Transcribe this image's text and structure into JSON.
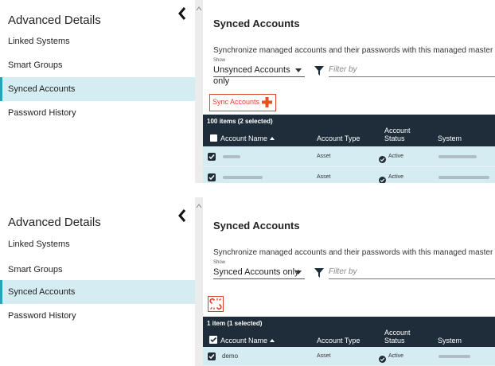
{
  "sidebar": {
    "title": "Advanced Details",
    "items": [
      {
        "label": "Linked Systems"
      },
      {
        "label": "Smart Groups"
      },
      {
        "label": "Synced Accounts"
      },
      {
        "label": "Password History"
      }
    ]
  },
  "panel1": {
    "title": "Synced Accounts",
    "description": "Synchronize managed accounts and their passwords with this managed master account.",
    "show_label": "Show",
    "show_value": "Unsynced Accounts only",
    "filter_placeholder": "Filter by",
    "sync_button": "Sync Accounts",
    "table": {
      "count": "100 items (2 selected)",
      "columns": {
        "name": "Account Name",
        "type": "Account Type",
        "status_line1": "Account",
        "status_line2": "Status",
        "system": "System"
      },
      "rows": [
        {
          "type": "Asset",
          "status": "Active"
        },
        {
          "type": "Asset",
          "status": "Active"
        }
      ]
    }
  },
  "panel2": {
    "title": "Synced Accounts",
    "description": "Synchronize managed accounts and their passwords with this managed master account.",
    "show_label": "Show",
    "show_value": "Synced Accounts only",
    "filter_placeholder": "Filter by",
    "table": {
      "count": "1 item (1 selected)",
      "columns": {
        "name": "Account Name",
        "type": "Account Type",
        "status_line1": "Account",
        "status_line2": "Status",
        "system": "System"
      },
      "rows": [
        {
          "name": "demo",
          "type": "Asset",
          "status": "Active"
        }
      ]
    }
  },
  "colors": {
    "accent": "#2aa0c0",
    "selected_row": "#d5ecf2",
    "header": "#1f2d3a",
    "action_red": "#d9442b"
  }
}
